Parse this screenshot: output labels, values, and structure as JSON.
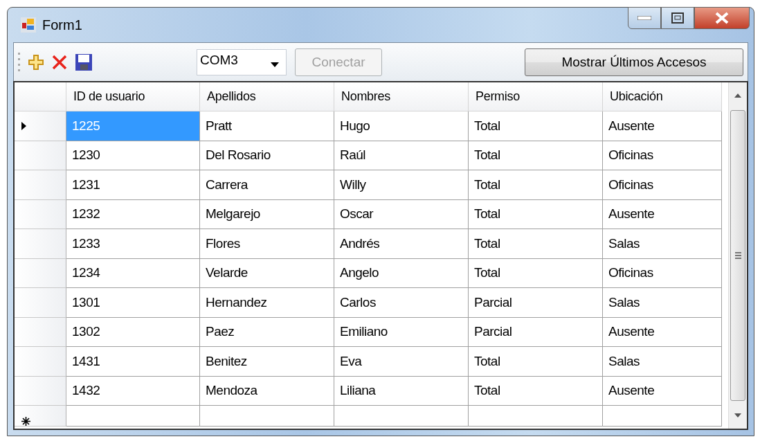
{
  "window": {
    "title": "Form1"
  },
  "toolbar": {
    "port": {
      "value": "COM3"
    },
    "connect_button": {
      "label": "Conectar",
      "disabled": true
    },
    "history_button": {
      "label": "Mostrar Últimos Accesos",
      "disabled": false
    }
  },
  "table": {
    "columns": [
      "ID de usuario",
      "Apellidos",
      "Nombres",
      "Permiso",
      "Ubicación"
    ],
    "rows": [
      {
        "current": true,
        "cells": [
          "1225",
          "Pratt",
          "Hugo",
          "Total",
          "Ausente"
        ]
      },
      {
        "current": false,
        "cells": [
          "1230",
          "Del Rosario",
          "Raúl",
          "Total",
          "Oficinas"
        ]
      },
      {
        "current": false,
        "cells": [
          "1231",
          "Carrera",
          "Willy",
          "Total",
          "Oficinas"
        ]
      },
      {
        "current": false,
        "cells": [
          "1232",
          "Melgarejo",
          "Oscar",
          "Total",
          "Ausente"
        ]
      },
      {
        "current": false,
        "cells": [
          "1233",
          "Flores",
          "Andrés",
          "Total",
          "Salas"
        ]
      },
      {
        "current": false,
        "cells": [
          "1234",
          "Velarde",
          "Angelo",
          "Total",
          "Oficinas"
        ]
      },
      {
        "current": false,
        "cells": [
          "1301",
          "Hernandez",
          "Carlos",
          "Parcial",
          "Salas"
        ]
      },
      {
        "current": false,
        "cells": [
          "1302",
          "Paez",
          "Emiliano",
          "Parcial",
          "Ausente"
        ]
      },
      {
        "current": false,
        "cells": [
          "1431",
          "Benitez",
          "Eva",
          "Total",
          "Salas"
        ]
      },
      {
        "current": false,
        "cells": [
          "1432",
          "Mendoza",
          "Liliana",
          "Total",
          "Ausente"
        ]
      }
    ],
    "new_row": true
  }
}
